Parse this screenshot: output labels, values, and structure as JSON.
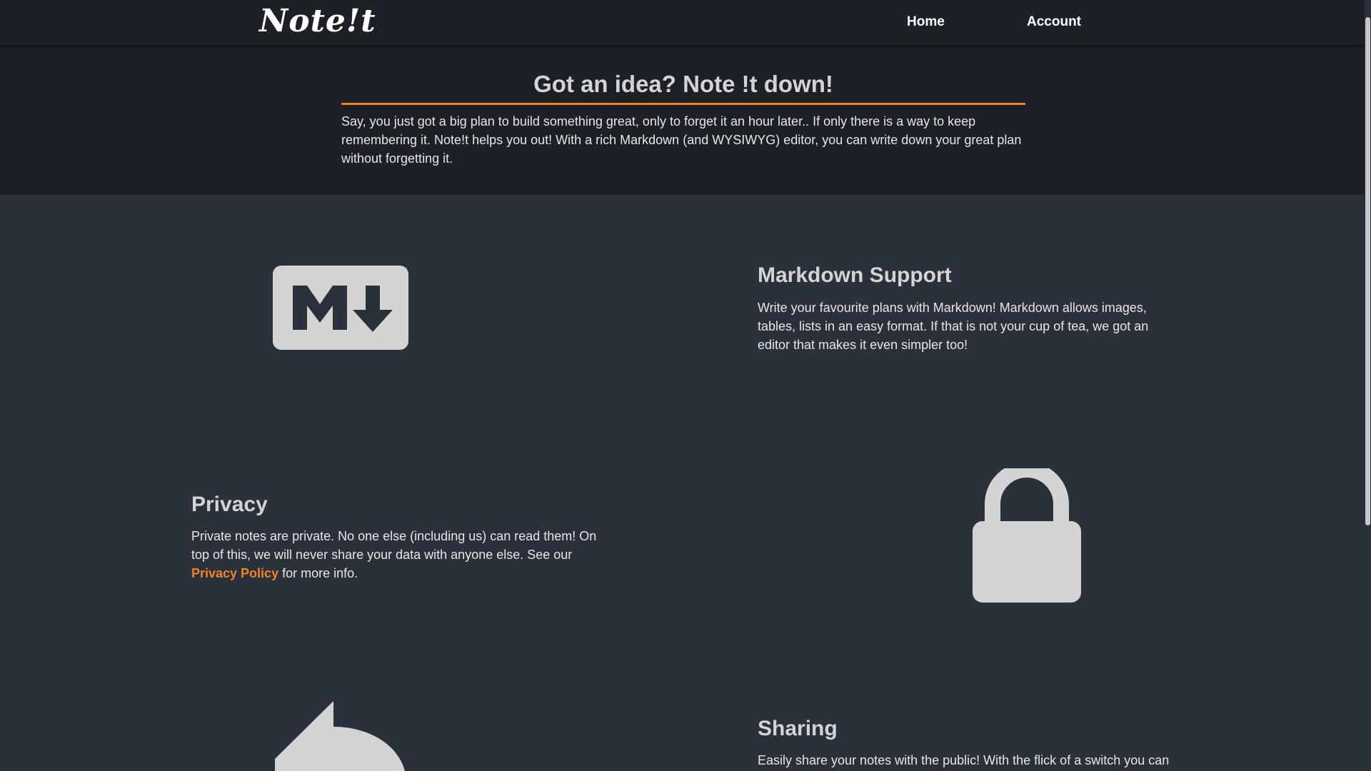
{
  "app": {
    "logo": "Note!t"
  },
  "nav": {
    "home": "Home",
    "account": "Account"
  },
  "hero": {
    "title": "Got an idea? Note !t down!",
    "text": "Say, you just got a big plan to build something great, only to forget it an hour later.. If only there is a way to keep remembering it. Note!t helps you out! With a rich Markdown (and WYSIWYG) editor, you can write down your great plan without forgetting it."
  },
  "features": {
    "markdown": {
      "icon": "markdown-icon",
      "title": "Markdown Support",
      "text": "Write your favourite plans with Markdown! Markdown allows images, tables, lists in an easy format. If that is not your cup of tea, we got an editor that makes it even simpler too!"
    },
    "privacy": {
      "icon": "lock-icon",
      "title": "Privacy",
      "text_before": "Private notes are private. No one else (including us) can read them! On top of this, we will never share your data with anyone else. See our",
      "link": "Privacy Policy",
      "text_after": "for more info."
    },
    "sharing": {
      "icon": "share-icon",
      "title": "Sharing",
      "text": "Easily share your notes with the public! With the flick of a switch you can"
    }
  },
  "colors": {
    "accent": "#f0832a",
    "background": "#2b313a",
    "header": "#1d2026",
    "icon": "#d4d4d4"
  }
}
